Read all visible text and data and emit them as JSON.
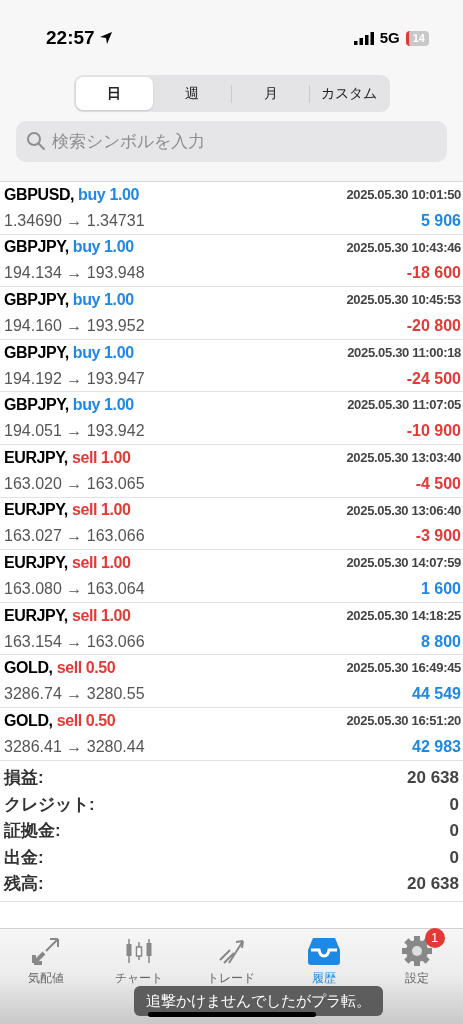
{
  "status_bar": {
    "time": "22:57",
    "network": "5G",
    "battery": "14"
  },
  "period_tabs": [
    {
      "label": "日",
      "selected": true
    },
    {
      "label": "週",
      "selected": false
    },
    {
      "label": "月",
      "selected": false
    },
    {
      "label": "カスタム",
      "selected": false
    }
  ],
  "search": {
    "placeholder": "検索シンボルを入力"
  },
  "deals": [
    {
      "symbol": "GBPUSD,",
      "kind": "buy",
      "order": "buy 1.00",
      "time": "2025.05.30 10:01:50",
      "prices": "1.34690 → 1.34731",
      "color": "#1e88e5",
      "profit": "5 906"
    },
    {
      "symbol": "GBPJPY,",
      "kind": "buy",
      "order": "buy 1.00",
      "time": "2025.05.30 10:43:46",
      "prices": "194.134 → 193.948",
      "color": "#e53935",
      "profit": "-18 600"
    },
    {
      "symbol": "GBPJPY,",
      "kind": "buy",
      "order": "buy 1.00",
      "time": "2025.05.30 10:45:53",
      "prices": "194.160 → 193.952",
      "color": "#e53935",
      "profit": "-20 800"
    },
    {
      "symbol": "GBPJPY,",
      "kind": "buy",
      "order": "buy 1.00",
      "time": "2025.05.30 11:00:18",
      "prices": "194.192 → 193.947",
      "color": "#e53935",
      "profit": "-24 500"
    },
    {
      "symbol": "GBPJPY,",
      "kind": "buy",
      "order": "buy 1.00",
      "time": "2025.05.30 11:07:05",
      "prices": "194.051 → 193.942",
      "color": "#e53935",
      "profit": "-10 900"
    },
    {
      "symbol": "EURJPY,",
      "kind": "sell",
      "order": "sell 1.00",
      "time": "2025.05.30 13:03:40",
      "prices": "163.020 → 163.065",
      "color": "#e53935",
      "profit": "-4 500"
    },
    {
      "symbol": "EURJPY,",
      "kind": "sell",
      "order": "sell 1.00",
      "time": "2025.05.30 13:06:40",
      "prices": "163.027 → 163.066",
      "color": "#e53935",
      "profit": "-3 900"
    },
    {
      "symbol": "EURJPY,",
      "kind": "sell",
      "order": "sell 1.00",
      "time": "2025.05.30 14:07:59",
      "prices": "163.080 → 163.064",
      "color": "#1e88e5",
      "profit": "1 600"
    },
    {
      "symbol": "EURJPY,",
      "kind": "sell",
      "order": "sell 1.00",
      "time": "2025.05.30 14:18:25",
      "prices": "163.154 → 163.066",
      "color": "#1e88e5",
      "profit": "8 800"
    },
    {
      "symbol": "GOLD,",
      "kind": "sell",
      "order": "sell 0.50",
      "time": "2025.05.30 16:49:45",
      "prices": "3286.74 → 3280.55",
      "color": "#1e88e5",
      "profit": "44 549"
    },
    {
      "symbol": "GOLD,",
      "kind": "sell",
      "order": "sell 0.50",
      "time": "2025.05.30 16:51:20",
      "prices": "3286.41 → 3280.44",
      "color": "#1e88e5",
      "profit": "42 983"
    }
  ],
  "summary": [
    {
      "label": "損益:",
      "value": "20 638"
    },
    {
      "label": "クレジット:",
      "value": "0"
    },
    {
      "label": "証拠金:",
      "value": "0"
    },
    {
      "label": "出金:",
      "value": "0"
    },
    {
      "label": "残高:",
      "value": "20 638"
    }
  ],
  "tab_bar": [
    {
      "kind": "quotes",
      "label": "気配値",
      "selected": false
    },
    {
      "kind": "chart",
      "label": "チャート",
      "selected": false
    },
    {
      "kind": "trade",
      "label": "トレード",
      "selected": false
    },
    {
      "kind": "history",
      "label": "履歴",
      "selected": true
    },
    {
      "kind": "settings",
      "label": "設定",
      "selected": false,
      "badge": "1"
    }
  ],
  "toast": "追撃かけませんでしたがプラ転。"
}
